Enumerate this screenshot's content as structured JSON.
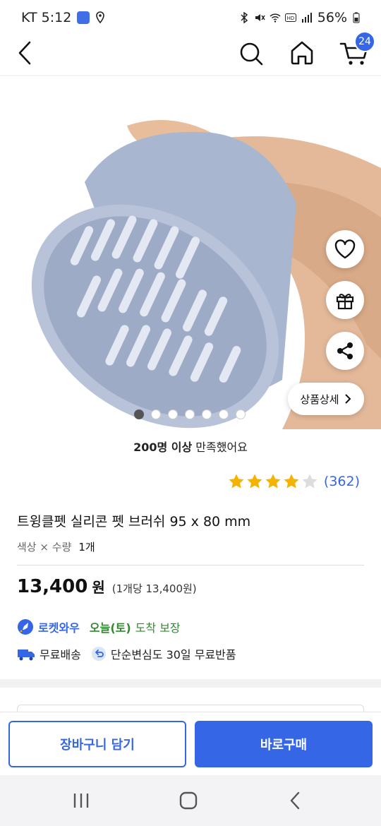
{
  "status_bar": {
    "carrier_time": "KT 5:12",
    "battery": "56%"
  },
  "nav": {
    "cart_count": "24"
  },
  "product": {
    "satisfaction_bold": "200명 이상",
    "satisfaction_rest": " 만족했어요",
    "rating": 4,
    "rating_max": 5,
    "review_count": "(362)",
    "title": "트윙클펫 실리콘 펫 브러쉬 95 x 80 mm",
    "option_label": "색상 × 수량",
    "option_value": "1개",
    "price": "13,400",
    "price_unit": "원",
    "price_per": "(1개당 13,400원)",
    "detail_button": "상품상세",
    "image_index": 1,
    "image_count": 7
  },
  "delivery": {
    "rocket_name": "로켓와우",
    "arrival_day": "오늘(토)",
    "arrival_rest": "도착 보장",
    "free_shipping": "무료배송",
    "free_return": "단순변심도 30일 무료반품"
  },
  "bottom": {
    "cart_button": "장바구니 담기",
    "buy_button": "바로구매"
  },
  "colors": {
    "accent": "#3466e6",
    "arrival": "#2f8a2f",
    "star": "#f5b301"
  },
  "icons": [
    "back-icon",
    "search-icon",
    "home-icon",
    "cart-icon",
    "heart-icon",
    "gift-icon",
    "share-icon",
    "chevron-right-icon",
    "rocket-icon",
    "truck-icon",
    "return-icon",
    "recent-apps-icon",
    "home-nav-icon",
    "back-nav-icon"
  ]
}
